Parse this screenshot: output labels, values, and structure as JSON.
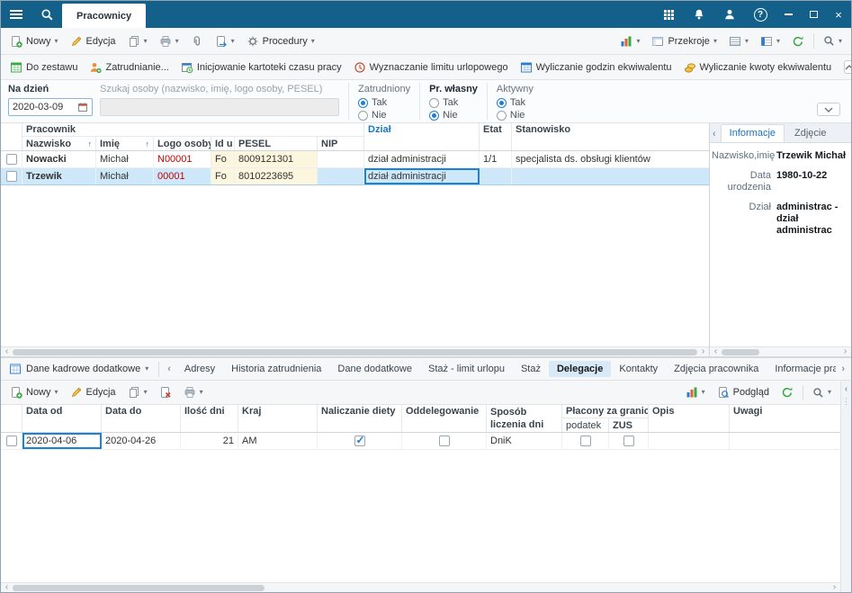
{
  "icons": {
    "caret": "▾",
    "chevron_left": "‹",
    "chevron_right": "›",
    "sort_up": "↑",
    "dots": "⋮",
    "help": "?",
    "close": "×"
  },
  "topbar": {
    "tab": "Pracownicy"
  },
  "toolbar": {
    "nowy": "Nowy",
    "edycja": "Edycja",
    "procedury": "Procedury",
    "przekroje": "Przekroje"
  },
  "actions": {
    "do_zestawu": "Do zestawu",
    "zatrudnianie": "Zatrudnianie...",
    "inicjowanie": "Inicjowanie kartoteki czasu pracy",
    "wyznaczanie": "Wyznaczanie limitu urlopowego",
    "godziny": "Wyliczanie godzin ekwiwalentu",
    "kwoty": "Wyliczanie kwoty ekwiwalentu"
  },
  "filters": {
    "na_dzien": {
      "label": "Na dzień",
      "value": "2020-03-09"
    },
    "search": {
      "placeholder": "Szukaj osoby (nazwisko, imię, logo osoby, PESEL)",
      "value": ""
    },
    "groups": [
      {
        "label": "Zatrudniony",
        "opt1": "Tak",
        "opt2": "Nie",
        "opt1_on": true,
        "opt2_on": false
      },
      {
        "label": "Pr. własny",
        "opt1": "Tak",
        "opt2": "Nie",
        "opt1_on": false,
        "opt2_on": true
      },
      {
        "label": "Aktywny",
        "opt1": "Tak",
        "opt2": "Nie",
        "opt1_on": true,
        "opt2_on": false
      }
    ]
  },
  "grid": {
    "group_header": "Pracownik",
    "headers": {
      "nazwisko": "Nazwisko",
      "imie": "Imię",
      "logo": "Logo osoby",
      "id": "Id u",
      "pesel": "PESEL",
      "nip": "NIP",
      "dzial": "Dział",
      "etat": "Etat",
      "stanowisko": "Stanowisko"
    },
    "rows": [
      {
        "nazwisko": "Nowacki",
        "imie": "Michał",
        "logo": "N00001",
        "id": "Fo",
        "pesel": "8009121301",
        "nip": "",
        "dzial": "dział administracji",
        "etat": "1/1",
        "stanowisko": "specjalista ds. obsługi klientów"
      },
      {
        "nazwisko": "Trzewik",
        "imie": "Michał",
        "logo": "00001",
        "id": "Fo",
        "pesel": "8010223695",
        "nip": "",
        "dzial": "dział administracji",
        "etat": "",
        "stanowisko": ""
      }
    ]
  },
  "info": {
    "tab_informacje": "Informacje",
    "tab_zdjecie": "Zdjęcie",
    "fields": [
      {
        "label": "Nazwisko,imię",
        "value": "Trzewik Michał"
      },
      {
        "label": "Data urodzenia",
        "value": "1980-10-22"
      },
      {
        "label": "Dział",
        "value": "administrac - dział administrac"
      }
    ]
  },
  "bottom": {
    "selector": "Dane kadrowe dodatkowe",
    "tabs": [
      "Adresy",
      "Historia zatrudnienia",
      "Dane dodatkowe",
      "Staż - limit urlopu",
      "Staż",
      "Delegacje",
      "Kontakty",
      "Zdjęcia pracownika",
      "Informacje pracow"
    ],
    "active_tab": "Delegacje",
    "toolbar": {
      "nowy": "Nowy",
      "edycja": "Edycja",
      "podglad": "Podgląd"
    },
    "headers": {
      "data_od": "Data od",
      "data_do": "Data do",
      "ilosc": "Ilość dni",
      "kraj": "Kraj",
      "naliczanie": "Naliczanie diety",
      "oddelegowanie": "Oddelegowanie",
      "sposob": "Sposób liczenia dni",
      "placony": "Płacony za granicą",
      "podatek": "podatek",
      "zus": "ZUS",
      "opis": "Opis",
      "uwagi": "Uwagi"
    },
    "row": {
      "data_od": "2020-04-06",
      "data_do": "2020-04-26",
      "ilosc": "21",
      "kraj": "AM",
      "naliczanie_on": true,
      "oddelegowanie_on": false,
      "sposob": "DniK",
      "podatek_on": false,
      "zus_on": false,
      "opis": "",
      "uwagi": ""
    }
  }
}
